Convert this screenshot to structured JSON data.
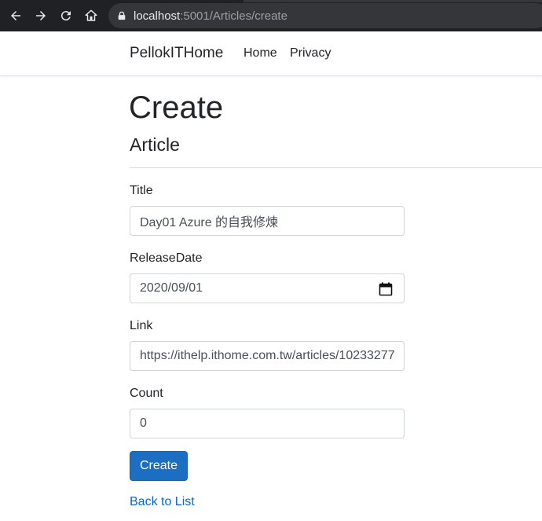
{
  "browser": {
    "url_host": "localhost",
    "url_rest": ":5001/Articles/create",
    "icons": [
      "back-arrow-icon",
      "forward-arrow-icon",
      "reload-icon",
      "home-icon",
      "lock-icon"
    ]
  },
  "navbar": {
    "brand": "PellokITHome",
    "links": [
      "Home",
      "Privacy"
    ]
  },
  "page": {
    "title": "Create",
    "subtitle": "Article"
  },
  "form": {
    "title": {
      "label": "Title",
      "value": "Day01 Azure 的自我修煉"
    },
    "release_date": {
      "label": "ReleaseDate",
      "value": "2020/09/01"
    },
    "link": {
      "label": "Link",
      "value": "https://ithelp.ithome.com.tw/articles/10233277"
    },
    "count": {
      "label": "Count",
      "value": "0"
    },
    "submit_label": "Create"
  },
  "back_link": "Back to List",
  "colors": {
    "primary_button": "#1b6ec2",
    "link": "#0366d6",
    "chrome_bg": "#202124"
  }
}
